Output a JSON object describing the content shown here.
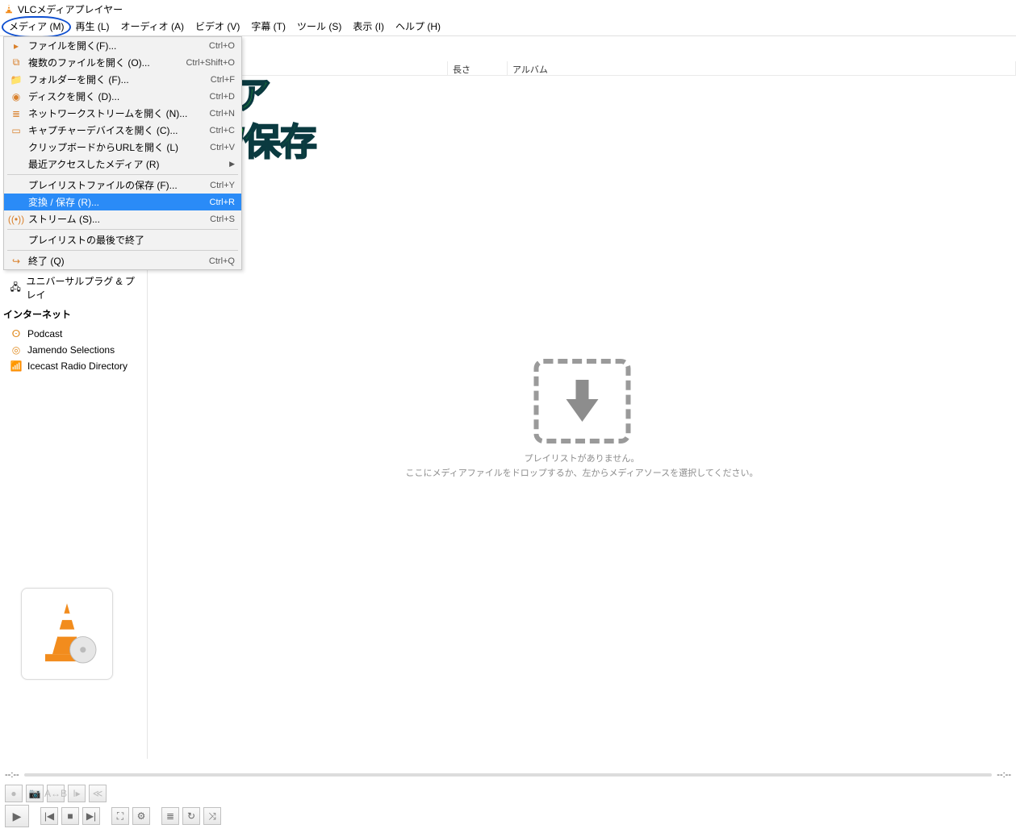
{
  "window": {
    "title": "VLCメディアプレイヤー"
  },
  "menubar": {
    "items": [
      {
        "label": "メディア (M)"
      },
      {
        "label": "再生 (L)"
      },
      {
        "label": "オーディオ (A)"
      },
      {
        "label": "ビデオ (V)"
      },
      {
        "label": "字幕 (T)"
      },
      {
        "label": "ツール (S)"
      },
      {
        "label": "表示 (I)"
      },
      {
        "label": "ヘルプ (H)"
      }
    ]
  },
  "media_menu": {
    "open_file": {
      "label": "ファイルを開く(F)...",
      "shortcut": "Ctrl+O"
    },
    "open_multi": {
      "label": "複数のファイルを開く (O)...",
      "shortcut": "Ctrl+Shift+O"
    },
    "open_folder": {
      "label": "フォルダーを開く (F)...",
      "shortcut": "Ctrl+F"
    },
    "open_disc": {
      "label": "ディスクを開く (D)...",
      "shortcut": "Ctrl+D"
    },
    "open_network": {
      "label": "ネットワークストリームを開く (N)...",
      "shortcut": "Ctrl+N"
    },
    "open_capture": {
      "label": "キャプチャーデバイスを開く (C)...",
      "shortcut": "Ctrl+C"
    },
    "open_clipboard": {
      "label": "クリップボードからURLを開く (L)",
      "shortcut": "Ctrl+V"
    },
    "recent": {
      "label": "最近アクセスしたメディア (R)"
    },
    "save_playlist": {
      "label": "プレイリストファイルの保存 (F)...",
      "shortcut": "Ctrl+Y"
    },
    "convert_save": {
      "label": "変換 / 保存 (R)...",
      "shortcut": "Ctrl+R"
    },
    "stream": {
      "label": "ストリーム (S)...",
      "shortcut": "Ctrl+S"
    },
    "quit_end": {
      "label": "プレイリストの最後で終了"
    },
    "quit": {
      "label": "終了 (Q)",
      "shortcut": "Ctrl+Q"
    }
  },
  "columns": {
    "length": "長さ",
    "album": "アルバム"
  },
  "sidebar": {
    "upnp": "ユニバーサルプラグ & プレイ",
    "internet_group": "インターネット",
    "podcast": "Podcast",
    "jamendo": "Jamendo Selections",
    "icecast": "Icecast Radio Directory"
  },
  "placeholder": {
    "line1": "プレイリストがありません。",
    "line2": "ここにメディアファイルをドロップするか、左からメディアソースを選択してください。"
  },
  "annotation": {
    "line1": "メディア",
    "line2": "→変換/保存"
  },
  "seek": {
    "left": "--:--",
    "right": "--:--"
  }
}
